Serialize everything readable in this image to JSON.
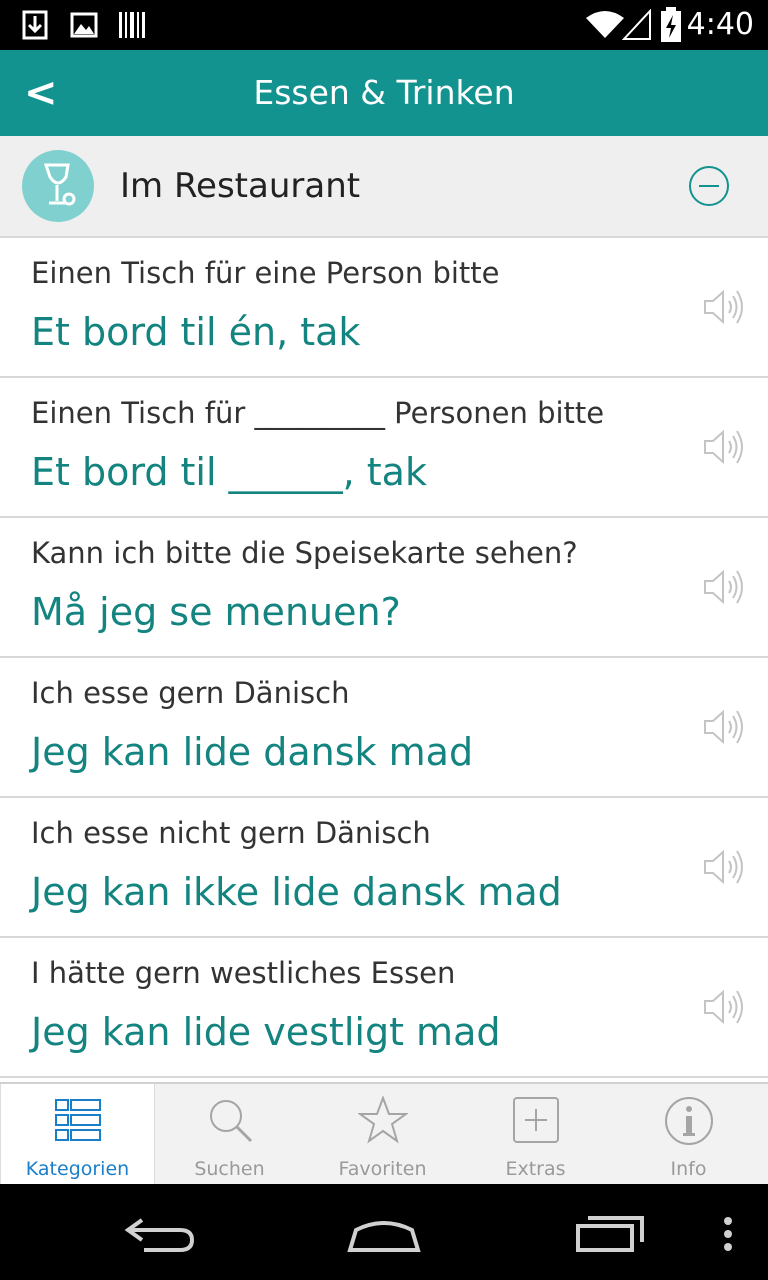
{
  "status_bar": {
    "time": "4:40",
    "icons": [
      "download-icon",
      "image-icon",
      "barcode-icon",
      "wifi-icon",
      "signal-icon",
      "battery-icon"
    ]
  },
  "header": {
    "back_label": "<",
    "title": "Essen & Trinken"
  },
  "section": {
    "icon": "wine-glass-icon",
    "title": "Im Restaurant",
    "collapse_icon": "minus-circle-icon"
  },
  "phrases": [
    {
      "de": "Einen Tisch für eine Person bitte",
      "da": "Et bord til én, tak"
    },
    {
      "de": "Einen Tisch für _________ Personen bitte",
      "da": "Et bord til ______, tak"
    },
    {
      "de": "Kann ich bitte die Speisekarte sehen?",
      "da": "Må jeg se menuen?"
    },
    {
      "de": "Ich esse gern Dänisch",
      "da": "Jeg kan lide dansk mad"
    },
    {
      "de": "Ich esse nicht gern Dänisch",
      "da": "Jeg kan ikke lide dansk mad"
    },
    {
      "de": "I hätte gern westliches Essen",
      "da": "Jeg kan lide vestligt mad"
    }
  ],
  "tabs": [
    {
      "label": "Kategorien",
      "icon": "list-icon",
      "active": true
    },
    {
      "label": "Suchen",
      "icon": "search-icon",
      "active": false
    },
    {
      "label": "Favoriten",
      "icon": "star-icon",
      "active": false
    },
    {
      "label": "Extras",
      "icon": "plus-box-icon",
      "active": false
    },
    {
      "label": "Info",
      "icon": "info-icon",
      "active": false
    }
  ],
  "colors": {
    "accent": "#12938f",
    "phrase_translation": "#13847f",
    "tab_active": "#1a7fc8"
  }
}
